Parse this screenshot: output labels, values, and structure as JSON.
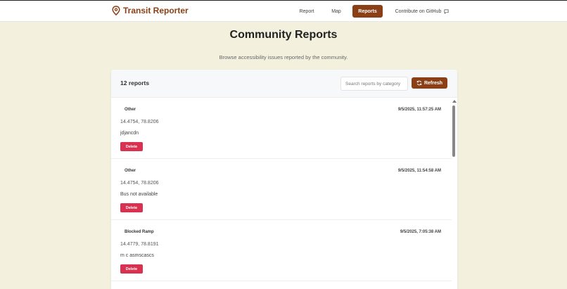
{
  "navbar": {
    "brand": "Transit Reporter",
    "links": [
      {
        "label": "Report"
      },
      {
        "label": "Map"
      },
      {
        "label": "Reports"
      },
      {
        "label": "Contribute on GitHub"
      }
    ]
  },
  "page": {
    "title": "Community Reports",
    "subtitle": "Browse accessibility issues reported by the community."
  },
  "toolbar": {
    "count": "12 reports",
    "search_placeholder": "Search reports by category",
    "refresh_label": "Refresh"
  },
  "reports": [
    {
      "category": "Other",
      "timestamp": "9/5/2025, 11:57:25 AM",
      "coords": "14.4754, 78.8206",
      "description": "jdjancdn",
      "delete_label": "Delete"
    },
    {
      "category": "Other",
      "timestamp": "9/5/2025, 11:54:58 AM",
      "coords": "14.4754, 78.8206",
      "description": "Bus not available",
      "delete_label": "Delete"
    },
    {
      "category": "Blocked Ramp",
      "timestamp": "9/5/2025, 7:05:38 AM",
      "coords": "14.4779, 78.8191",
      "description": "m c asmscascs",
      "delete_label": "Delete"
    }
  ],
  "colors": {
    "brand": "#8b3f17",
    "background": "#f3f1de",
    "delete": "#d9314f"
  }
}
